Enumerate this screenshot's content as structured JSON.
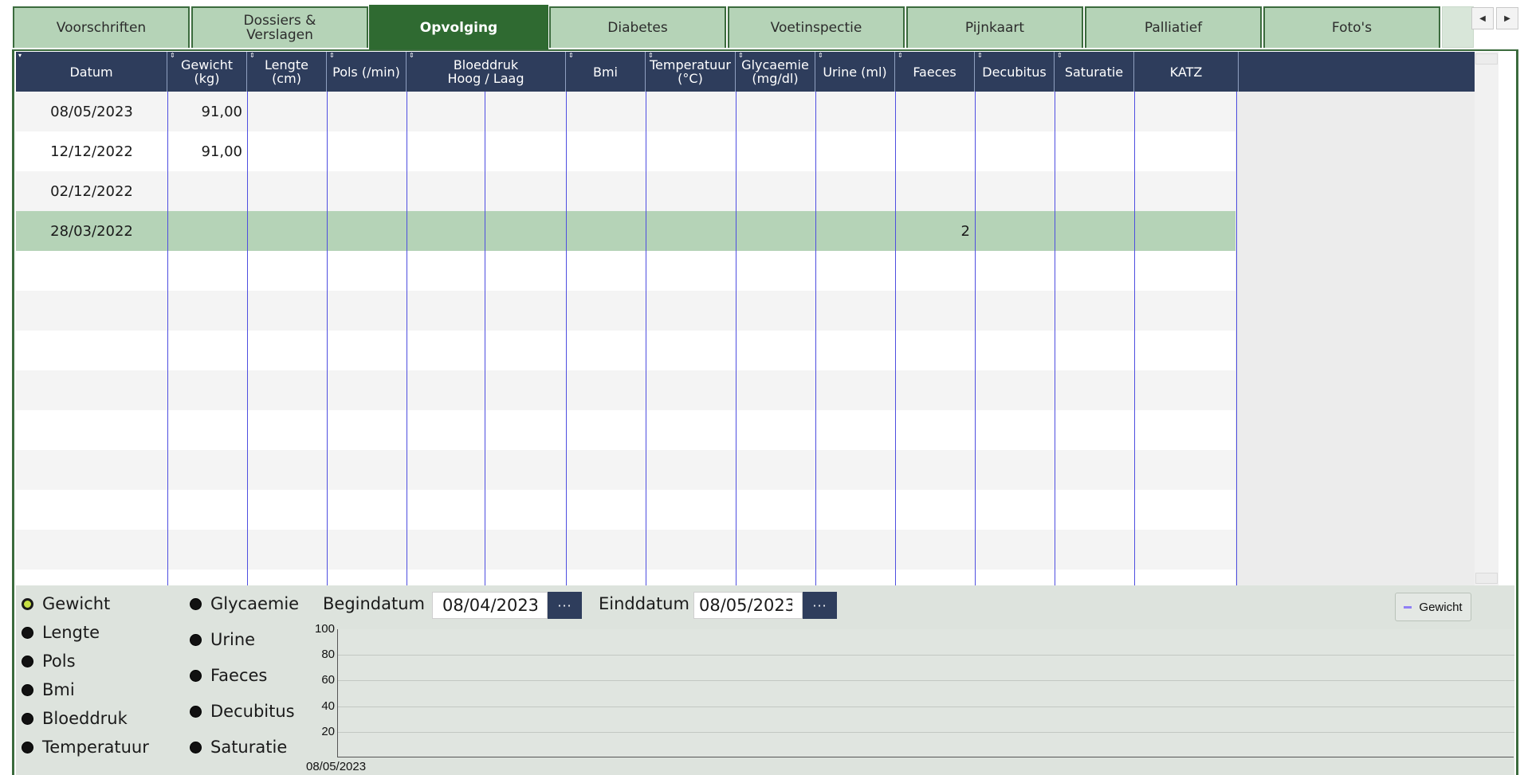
{
  "tabs": [
    {
      "label": "Voorschriften",
      "active": false
    },
    {
      "label": "Dossiers & Verslagen",
      "active": false
    },
    {
      "label": "Opvolging",
      "active": true
    },
    {
      "label": "Diabetes",
      "active": false
    },
    {
      "label": "Voetinspectie",
      "active": false
    },
    {
      "label": "Pijnkaart",
      "active": false
    },
    {
      "label": "Palliatief",
      "active": false
    },
    {
      "label": "Foto's",
      "active": false
    }
  ],
  "grid": {
    "columns": [
      {
        "label": "Datum"
      },
      {
        "label": "Gewicht (kg)"
      },
      {
        "label": "Lengte (cm)"
      },
      {
        "label": "Pols (/min)"
      },
      {
        "label": "Bloeddruk Hoog / Laag"
      },
      {
        "label": "Bmi"
      },
      {
        "label": "Temperatuur (°C)"
      },
      {
        "label": "Glycaemie (mg/dl)"
      },
      {
        "label": "Urine (ml)"
      },
      {
        "label": "Faeces"
      },
      {
        "label": "Decubitus"
      },
      {
        "label": "Saturatie"
      },
      {
        "label": "KATZ"
      }
    ],
    "rows": [
      {
        "datum": "08/05/2023",
        "gewicht": "91,00",
        "faeces": ""
      },
      {
        "datum": "12/12/2022",
        "gewicht": "91,00",
        "faeces": ""
      },
      {
        "datum": "02/12/2022",
        "gewicht": "",
        "faeces": ""
      },
      {
        "datum": "28/03/2022",
        "gewicht": "",
        "faeces": "2"
      }
    ]
  },
  "filters": {
    "left": [
      "Gewicht",
      "Lengte",
      "Pols",
      "Bmi",
      "Bloeddruk",
      "Temperatuur"
    ],
    "right": [
      "Glycaemie",
      "Urine",
      "Faeces",
      "Decubitus",
      "Saturatie"
    ],
    "selected": "Gewicht"
  },
  "dates": {
    "begin_label": "Begindatum",
    "begin_value": "08/04/2023",
    "end_label": "Einddatum",
    "end_value": "08/05/2023",
    "picker_label": "···"
  },
  "chart_data": {
    "type": "line",
    "title": "",
    "xlabel": "",
    "ylabel": "",
    "x": [
      "08/05/2023"
    ],
    "yticks": [
      20,
      40,
      60,
      80,
      100
    ],
    "ylim": [
      0,
      100
    ],
    "grid": true,
    "legend_placement": "top-right",
    "series": [
      {
        "name": "Gewicht",
        "values": [],
        "color": "#8f7ff5"
      }
    ]
  }
}
